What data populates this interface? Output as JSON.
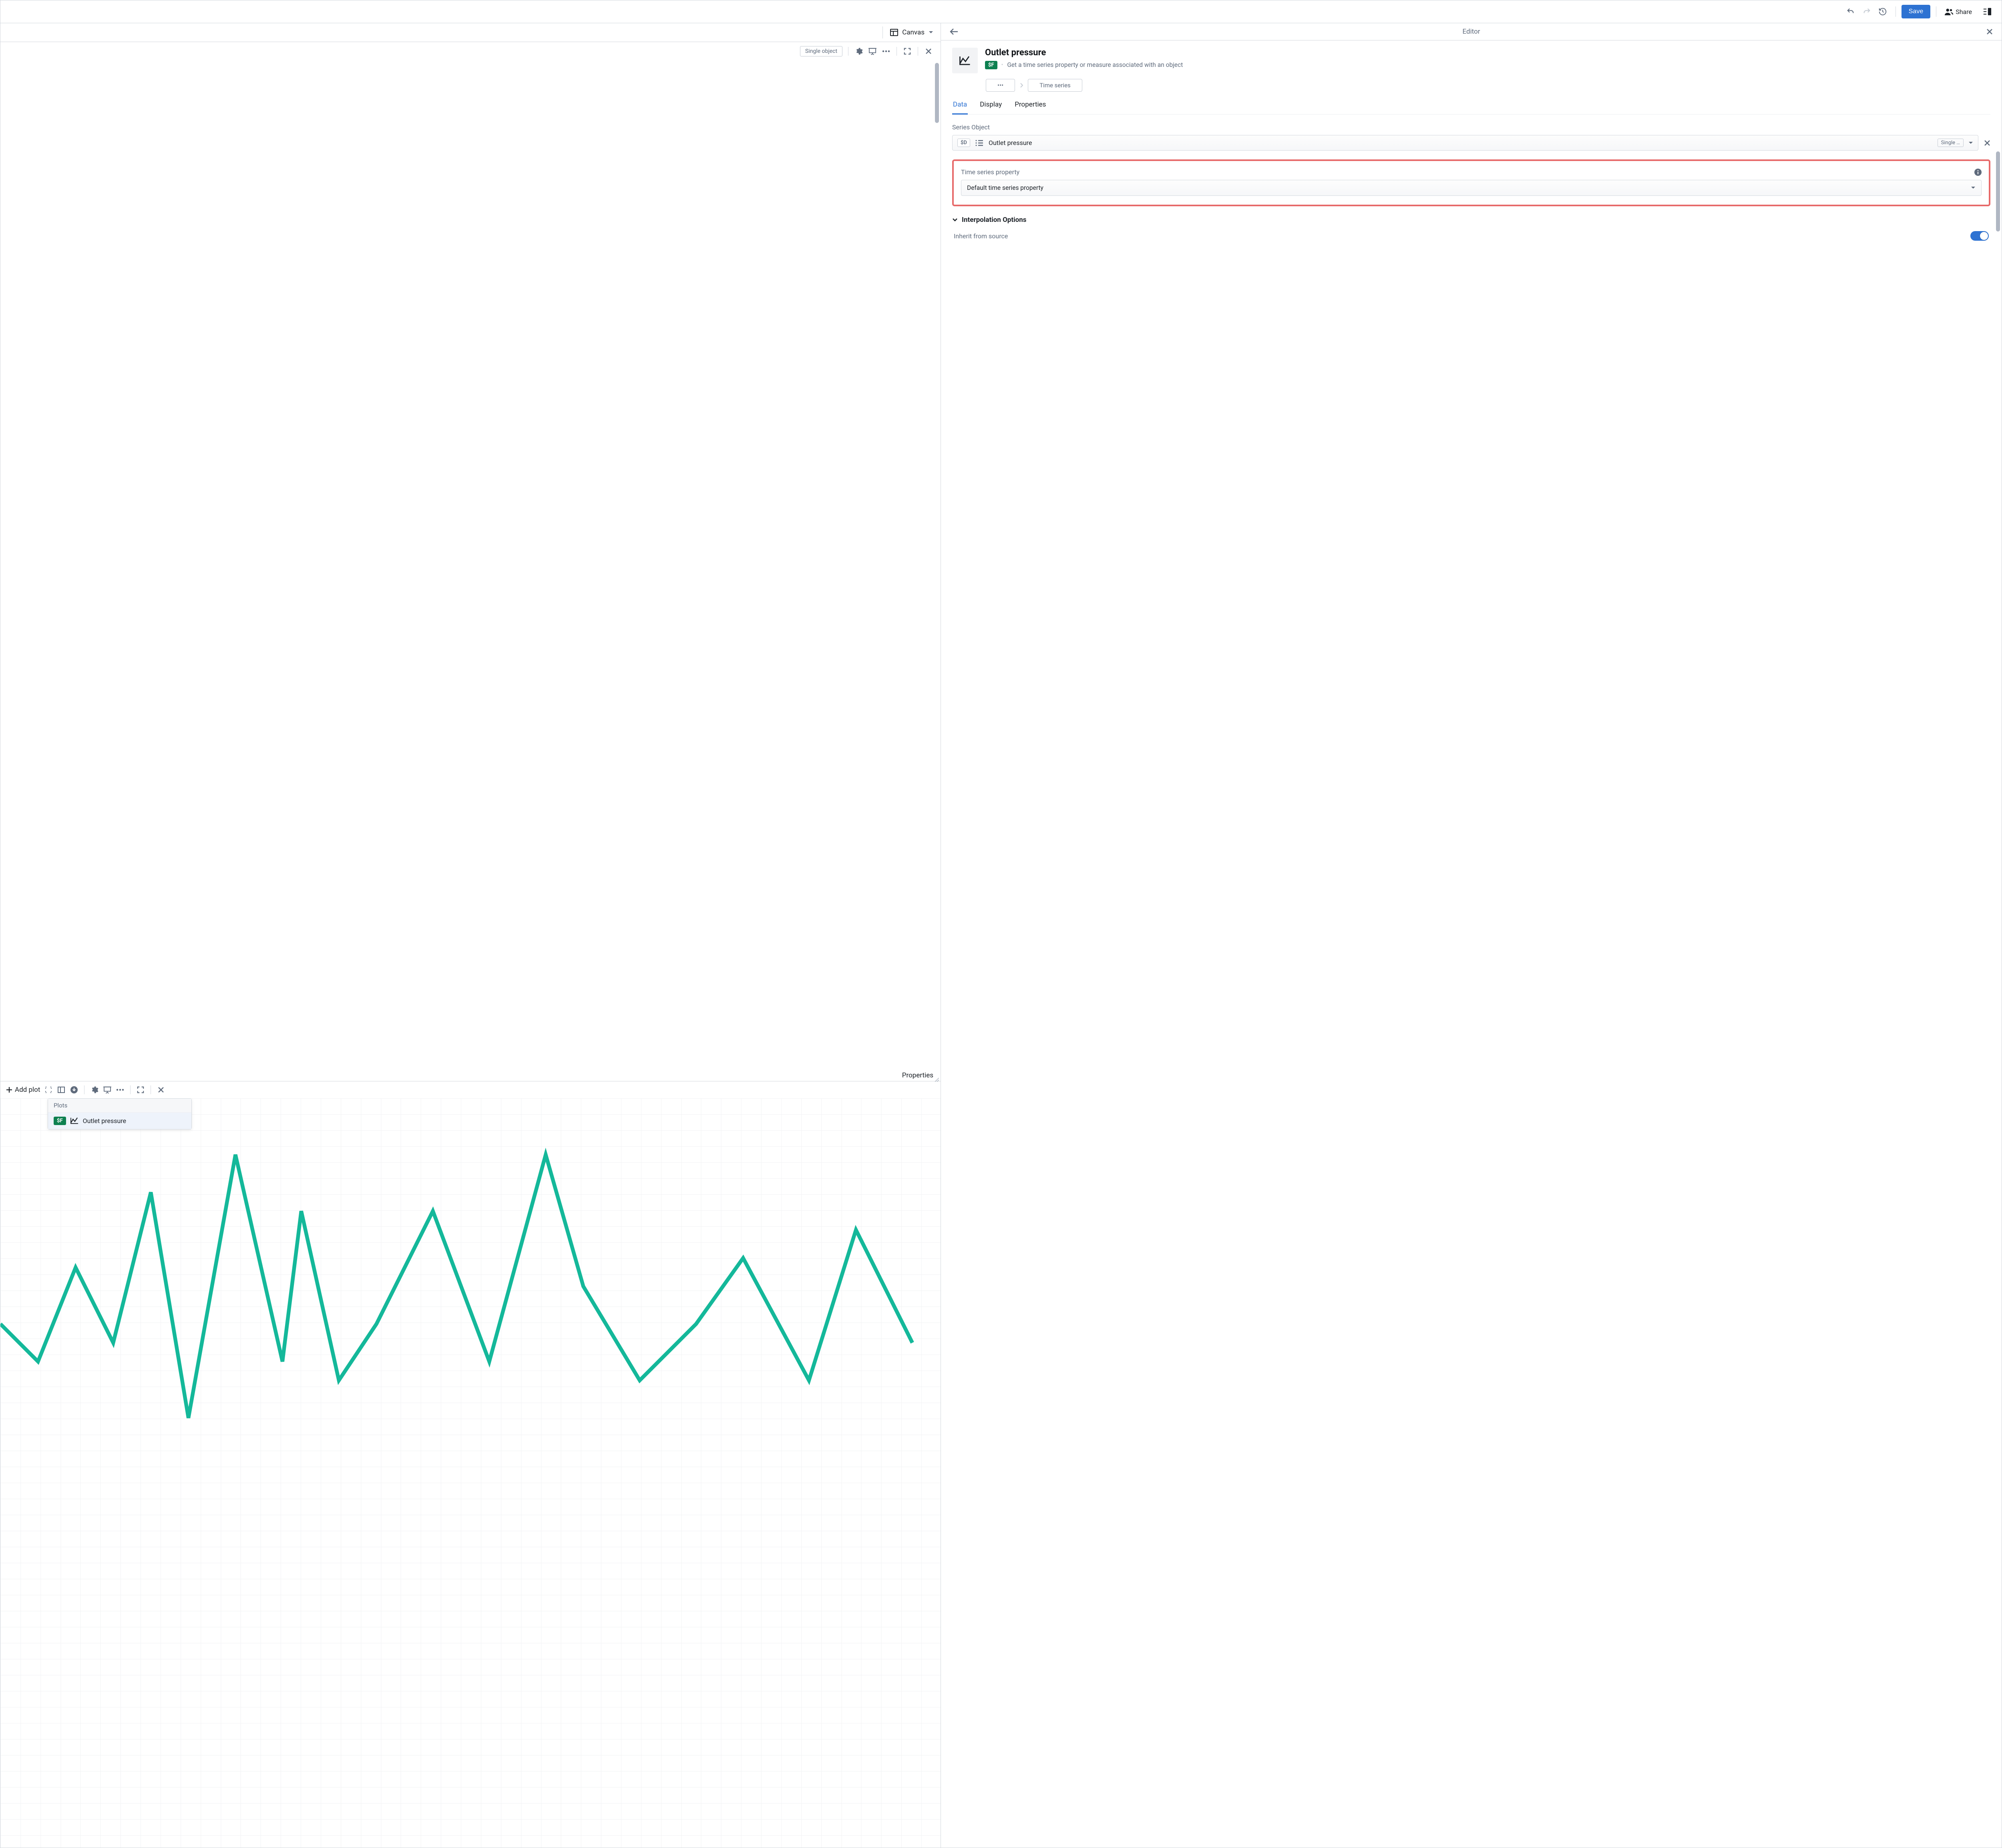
{
  "topbar": {
    "save_label": "Save",
    "share_label": "Share"
  },
  "canvas": {
    "dropdown_label": "Canvas",
    "single_object_chip": "Single object",
    "properties_label": "Properties"
  },
  "plot_panel": {
    "add_plot_label": "Add plot",
    "popup_header": "Plots",
    "popup_badge": "$F",
    "popup_item": "Outlet pressure"
  },
  "editor": {
    "title": "Editor",
    "series_title": "Outlet pressure",
    "series_badge": "$F",
    "series_desc": "Get a time series property or measure associated with an object",
    "breadcrumb_more": "•••",
    "breadcrumb_ts": "Time series",
    "tabs": {
      "data": "Data",
      "display": "Display",
      "properties": "Properties"
    },
    "series_object_label": "Series Object",
    "series_object_badge": "$D",
    "series_object_value": "Outlet pressure",
    "series_object_tag": "Single …",
    "tsp_label": "Time series property",
    "tsp_value": "Default time series property",
    "interp_header": "Interpolation Options",
    "inherit_label": "Inherit from source"
  }
}
